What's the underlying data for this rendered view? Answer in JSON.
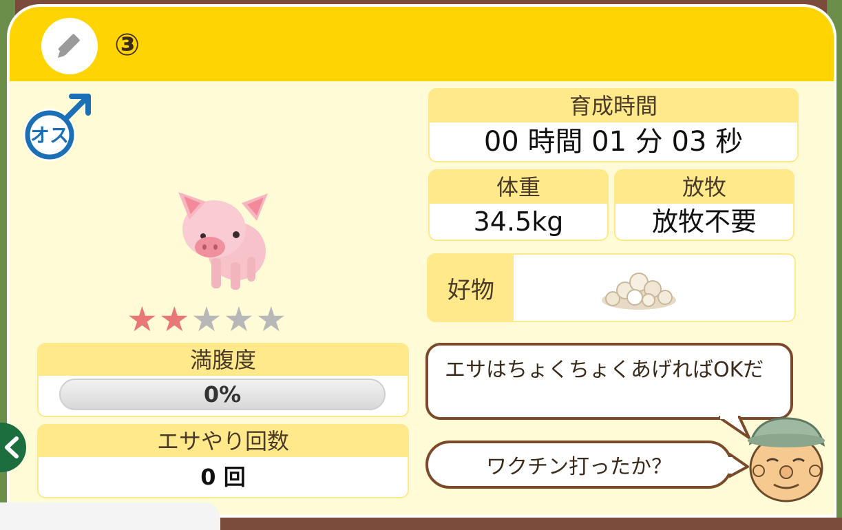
{
  "header": {
    "pig_number": "③"
  },
  "pig": {
    "gender_label": "オス",
    "stars_filled": 2,
    "stars_total": 5
  },
  "satiety": {
    "label": "満腹度",
    "value": "0%",
    "percent": 0
  },
  "feed_count": {
    "label": "エサやり回数",
    "value": "0 回"
  },
  "growth_time": {
    "label": "育成時間",
    "value": "00 時間 01 分 03 秒"
  },
  "weight": {
    "label": "体重",
    "value": "34.5kg"
  },
  "grazing": {
    "label": "放牧",
    "value": "放牧不要"
  },
  "favorite": {
    "label": "好物"
  },
  "dialog": {
    "tip": "エサはちょくちょくあげればOKだ",
    "question": "ワクチン打ったか？"
  },
  "colors": {
    "header": "#ffd400",
    "panel": "#fffbd6",
    "label_bg": "#ffe98a",
    "star_on": "#e87777",
    "star_off": "#b8b8b8",
    "gender": "#1a6fb5"
  }
}
